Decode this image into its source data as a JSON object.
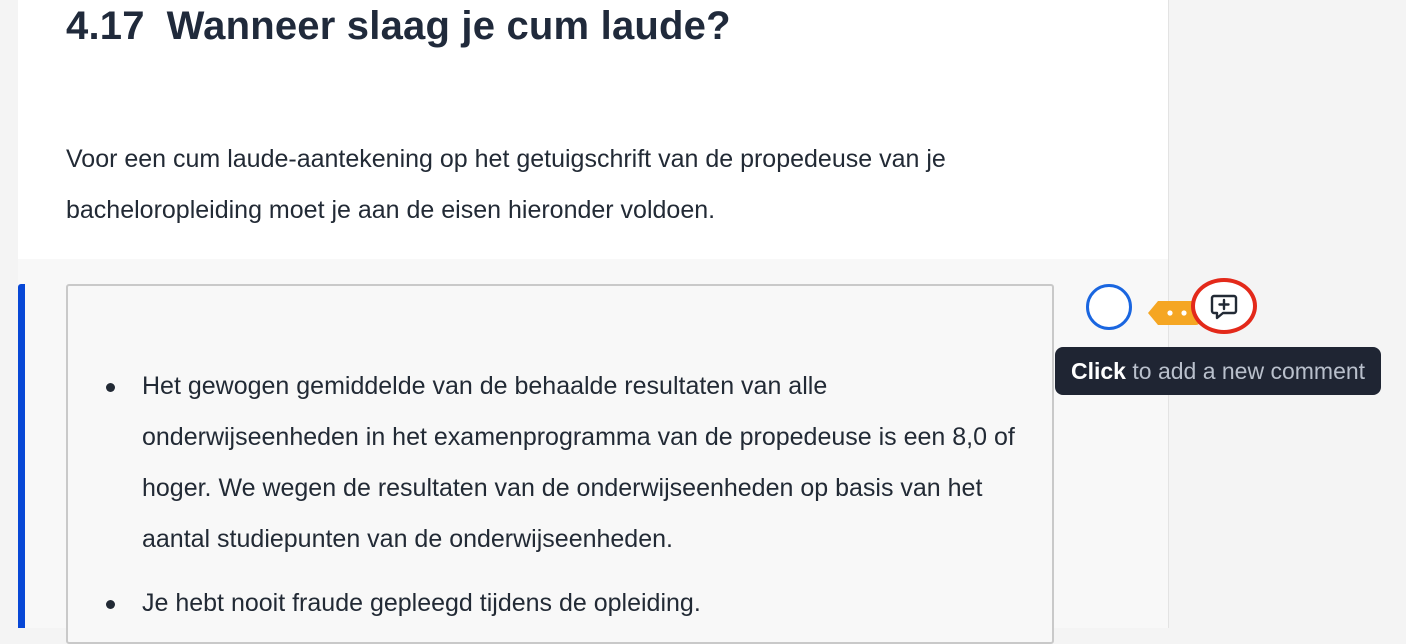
{
  "document": {
    "section_number": "4.17",
    "section_title": "Wanneer slaag je cum laude?",
    "intro_text": "Voor een cum laude-aantekening op het getuigschrift van de propedeuse van je bacheloropleiding moet je aan de eisen hieronder voldoen.",
    "requirements": [
      "Het gewogen gemiddelde van de behaalde resultaten van alle onderwijseenheden in het examenprogramma van de propedeuse is een 8,0 of hoger. We wegen de resultaten van de onderwijseenheden op basis van het aantal studiepunten van de onderwijseenheden.",
      "Je hebt nooit fraude gepleegd tijdens de opleiding."
    ]
  },
  "side_controls": {
    "marker_icon": "circle-outline-icon",
    "tag_icon": "tag-icon",
    "comment_icon": "add-comment-icon"
  },
  "tooltip": {
    "strong_text": "Click",
    "rest_text": "to add a new comment"
  },
  "colors": {
    "selection_bar": "#0747d6",
    "marker_ring": "#1a66e0",
    "tag": "#f5a623",
    "highlight_ring": "#e3291a",
    "tooltip_bg": "#1f2533"
  }
}
